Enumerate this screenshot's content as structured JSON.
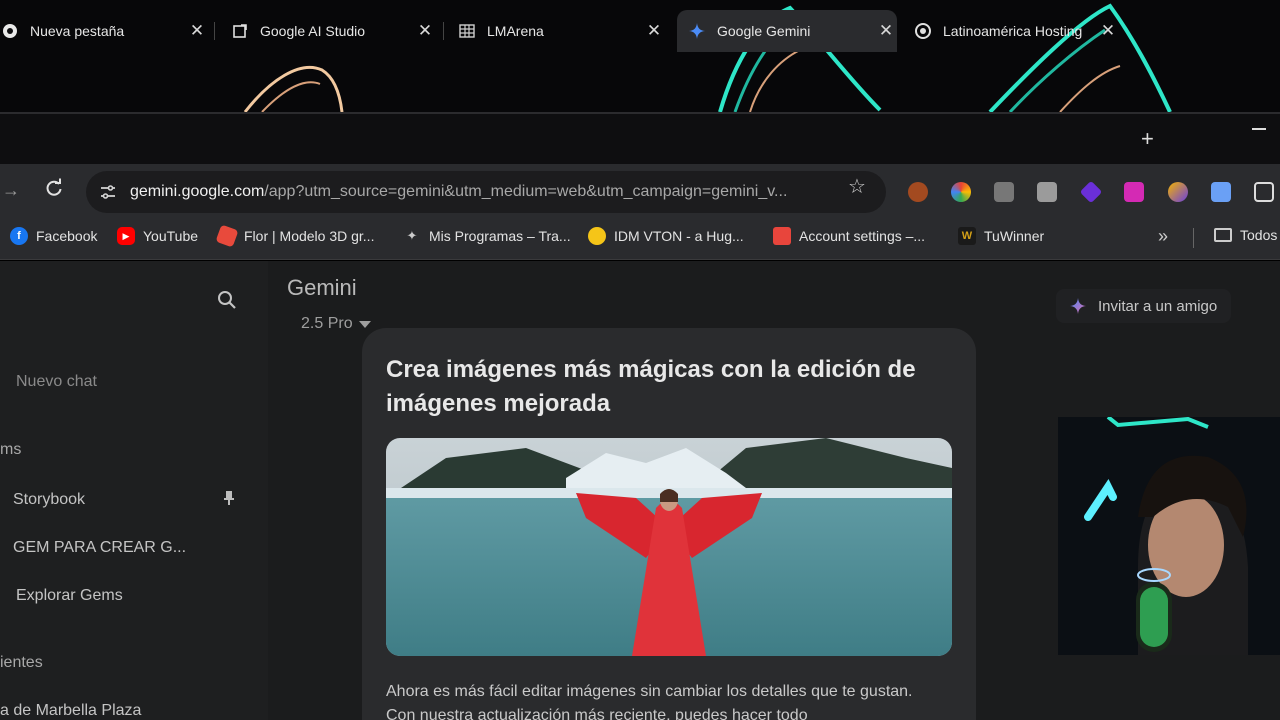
{
  "tabs": [
    {
      "title": "Nueva pestaña",
      "icon": "chrome-icon"
    },
    {
      "title": "Google AI Studio",
      "icon": "ai-studio-icon"
    },
    {
      "title": "LMArena",
      "icon": "table-icon"
    },
    {
      "title": "Google Gemini",
      "icon": "gemini-icon",
      "active": true
    },
    {
      "title": "Latinoamérica Hosting",
      "icon": "hosting-icon"
    }
  ],
  "tab_close_glyph": "✕",
  "new_tab_glyph": "+",
  "address": {
    "host": "gemini.google.com",
    "path": "/app?utm_source=gemini&utm_medium=web&utm_campaign=gemini_v..."
  },
  "bookmarks": [
    {
      "label": "Facebook",
      "icon": "facebook-icon",
      "color": "#1877f2",
      "glyph": "f"
    },
    {
      "label": "YouTube",
      "icon": "youtube-icon",
      "color": "#ff0000",
      "glyph": "▶"
    },
    {
      "label": "Flor | Modelo 3D gr...",
      "icon": "flower-icon",
      "color": "#e84a3c",
      "glyph": ""
    },
    {
      "label": "Mis Programas – Tra...",
      "icon": "programs-icon",
      "color": "#444444",
      "glyph": "✦"
    },
    {
      "label": "IDM VTON - a Hug...",
      "icon": "hugging-face-icon",
      "color": "#f5c518",
      "glyph": ""
    },
    {
      "label": "Account settings –...",
      "icon": "account-settings-icon",
      "color": "#e8453c",
      "glyph": ""
    },
    {
      "label": "TuWinner",
      "icon": "tuwinner-icon",
      "color": "#d4a017",
      "glyph": "W"
    },
    {
      "label": "Todos",
      "icon": "folder-icon",
      "color": "#cccccc",
      "glyph": ""
    }
  ],
  "sidebar": {
    "new_chat": "Nuevo chat",
    "gems_heading": "ms",
    "gems": [
      "Storybook",
      "GEM PARA CREAR G...",
      "Explorar Gems"
    ],
    "recents_heading": "ientes",
    "recents": [
      "a de Marbella Plaza"
    ]
  },
  "main": {
    "app_name": "Gemini",
    "model": "2.5 Pro",
    "invite_label": "Invitar a un amigo"
  },
  "promo": {
    "title": "Crea imágenes más mágicas con la edición de imágenes mejorada",
    "body": "Ahora es más fácil editar imágenes sin cambiar los detalles que te gustan. Con nuestra actualización más reciente, puedes hacer todo"
  },
  "colors": {
    "accent_cyan": "#2ee6c8",
    "gemini_blue": "#4b8bf5"
  }
}
